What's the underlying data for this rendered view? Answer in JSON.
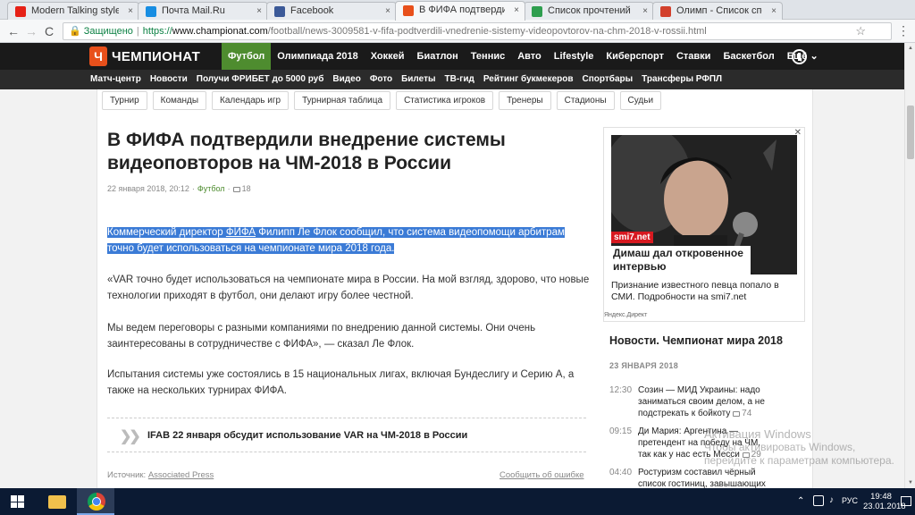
{
  "browser": {
    "tabs": [
      {
        "label": "Modern Talking style",
        "color": "#e62117",
        "active": false
      },
      {
        "label": "Почта Mail.Ru",
        "color": "#168de2",
        "active": false
      },
      {
        "label": "Facebook",
        "color": "#3b5998",
        "active": false
      },
      {
        "label": "В ФИФА подтвердили в",
        "color": "#e8501b",
        "active": true
      },
      {
        "label": "Список прочтений авто",
        "color": "#2e9e4f",
        "active": false
      },
      {
        "label": "Олимп - Список спорт",
        "color": "#d2402c",
        "active": false
      }
    ],
    "tab_close": "×",
    "back": "←",
    "forward": "→",
    "reload": "C",
    "secure_label": "Защищено",
    "url_scheme": "https://",
    "url_host": "www.championat.com",
    "url_path": "/football/news-3009581-v-fifa-podtverdili-vnedrenie-sistemy-videopovtorov-na-chm-2018-v-rossii.html",
    "star": "☆",
    "menu": "⋮"
  },
  "site": {
    "logo_mark": "Ч",
    "logo_text": "ЧЕМПИОНАТ",
    "main_nav": [
      "Футбол",
      "Олимпиада 2018",
      "Хоккей",
      "Биатлон",
      "Теннис",
      "Авто",
      "Lifestyle",
      "Киберспорт",
      "Ставки",
      "Баскетбол",
      "Ещё ⌄"
    ],
    "main_nav_active": 0,
    "sub_nav": [
      "Матч-центр",
      "Новости",
      "Получи ФРИБЕТ до 5000 руб",
      "Видео",
      "Фото",
      "Билеты",
      "ТВ-гид",
      "Рейтинг букмекеров",
      "Спортбары",
      "Трансферы РФПЛ"
    ],
    "accent": "#4e8c2f",
    "brand": "#e8501b"
  },
  "article": {
    "pills": [
      "Турнир",
      "Команды",
      "Календарь игр",
      "Турнирная таблица",
      "Статистика игроков",
      "Тренеры",
      "Стадионы",
      "Судьи"
    ],
    "headline": "В ФИФА подтвердили внедрение системы видеоповторов на ЧМ-2018 в России",
    "date": "22 января 2018, 20:12",
    "dot": "·",
    "category": "Футбол",
    "comments": "18",
    "p1_a": "Коммерческий директор ",
    "p1_link": "ФИФА",
    "p1_b": " Филипп Ле Флок сообщил, что система видеопомощи арбитрам точно будет использоваться на чемпионате мира 2018 года.",
    "p2": "«VAR точно будет использоваться на чемпионате мира в России. На мой взгляд, здорово, что новые технологии приходят в футбол, они делают игру более честной.",
    "p3": "Мы ведем переговоры с разными компаниями по внедрению данной системы. Они очень заинтересованы в сотрудничестве с ФИФА», — сказал Ле Флок.",
    "p4": "Испытания системы уже состоялись в 15 национальных лигах, включая Бундеслигу и Серию А, а также на нескольких турнирах ФИФА.",
    "related_chev": "❯❯",
    "related": "IFAB 22 января обсудит использование VAR на ЧМ-2018 в России",
    "source_label": "Источник: ",
    "source": "Associated Press",
    "report": "Сообщить об ошибке"
  },
  "ad": {
    "close": "✕",
    "tag": "smi7.net",
    "title": "Димаш дал откровенное интервью",
    "desc": "Признание известного певца попало в СМИ. Подробности на smi7.net",
    "provider": "Яндекс.Директ"
  },
  "news": {
    "title": "Новости. Чемпионат мира 2018",
    "date": "23 ЯНВАРЯ 2018",
    "items": [
      {
        "time": "12:30",
        "text": "Созин — МИД Украины: надо заниматься своим делом, а не подстрекать к бойкоту",
        "comments": "74"
      },
      {
        "time": "09:15",
        "text": "Ди Мария: Аргентина — претендент на победу на ЧМ, так как у нас есть Месси",
        "comments": "29"
      },
      {
        "time": "04:40",
        "text": "Ростуризм составил чёрный список гостиниц, завышающих цены к",
        "comments": ""
      }
    ]
  },
  "watermark": {
    "title": "Активация Windows",
    "text": "Чтобы активировать Windows, перейдите к параметрам компьютера."
  },
  "taskbar": {
    "tray_arrow": "⌃",
    "volume": "♪",
    "lang": "РУС",
    "time": "19:48",
    "date": "23.01.2018"
  }
}
